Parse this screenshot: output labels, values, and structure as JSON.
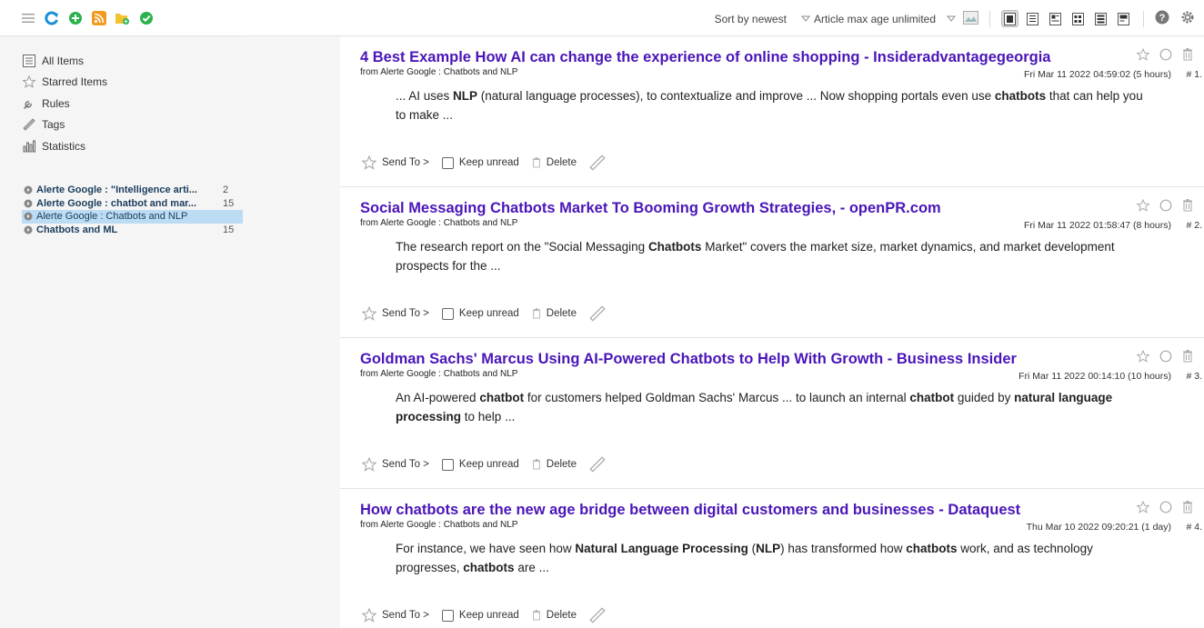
{
  "toolbar": {
    "sort_label": "Sort by newest",
    "max_age_label": "Article max age unlimited"
  },
  "sidebar": {
    "nav": [
      {
        "label": "All Items",
        "icon": "list-icon"
      },
      {
        "label": "Starred Items",
        "icon": "star-icon"
      },
      {
        "label": "Rules",
        "icon": "wrench-icon"
      },
      {
        "label": "Tags",
        "icon": "tag-icon"
      },
      {
        "label": "Statistics",
        "icon": "chart-icon"
      }
    ],
    "feeds": [
      {
        "name": "Alerte Google : \"Intelligence arti...",
        "count": "2",
        "bold": true,
        "selected": false
      },
      {
        "name": "Alerte Google : chatbot and mar...",
        "count": "15",
        "bold": true,
        "selected": false
      },
      {
        "name": "Alerte Google : Chatbots and NLP",
        "count": "",
        "bold": false,
        "selected": true
      },
      {
        "name": "Chatbots and ML",
        "count": "15",
        "bold": true,
        "selected": false
      }
    ]
  },
  "articles": [
    {
      "title": "4 Best Example How AI can change the experience of online shopping - Insideradvantagegeorgia",
      "from": "from Alerte Google : Chatbots and NLP",
      "date": "Fri Mar 11 2022 04:59:02 (5 hours)",
      "num": "# 1.",
      "excerpt_html": "... AI uses <b>NLP</b> (natural language processes), to contextualize and improve ... Now shopping portals even use <b>chatbots</b> that can help you to make ..."
    },
    {
      "title": "Social Messaging Chatbots Market To Booming Growth Strategies, - openPR.com",
      "from": "from Alerte Google : Chatbots and NLP",
      "date": "Fri Mar 11 2022 01:58:47 (8 hours)",
      "num": "# 2.",
      "excerpt_html": "The research report on the \"Social Messaging <b>Chatbots</b> Market\" covers the market size, market dynamics, and market development prospects for the ..."
    },
    {
      "title": "Goldman Sachs' Marcus Using AI-Powered Chatbots to Help With Growth - Business Insider",
      "from": "from Alerte Google : Chatbots and NLP",
      "date": "Fri Mar 11 2022 00:14:10 (10 hours)",
      "num": "# 3.",
      "excerpt_html": "An AI-powered <b>chatbot</b> for customers helped Goldman Sachs' Marcus ... to launch an internal <b>chatbot</b> guided by <b>natural language processing</b> to help ..."
    },
    {
      "title": "How chatbots are the new age bridge between digital customers and businesses - Dataquest",
      "from": "from Alerte Google : Chatbots and NLP",
      "date": "Thu Mar 10 2022 09:20:21 (1 day)",
      "num": "# 4.",
      "excerpt_html": "For instance, we have seen how <b>Natural Language Processing</b> (<b>NLP</b>) has transformed how <b>chatbots</b> work, and as technology progresses, <b>chatbots</b> are ..."
    }
  ],
  "article_footer": {
    "send_to": "Send To >",
    "keep_unread": "Keep unread",
    "delete": "Delete"
  }
}
